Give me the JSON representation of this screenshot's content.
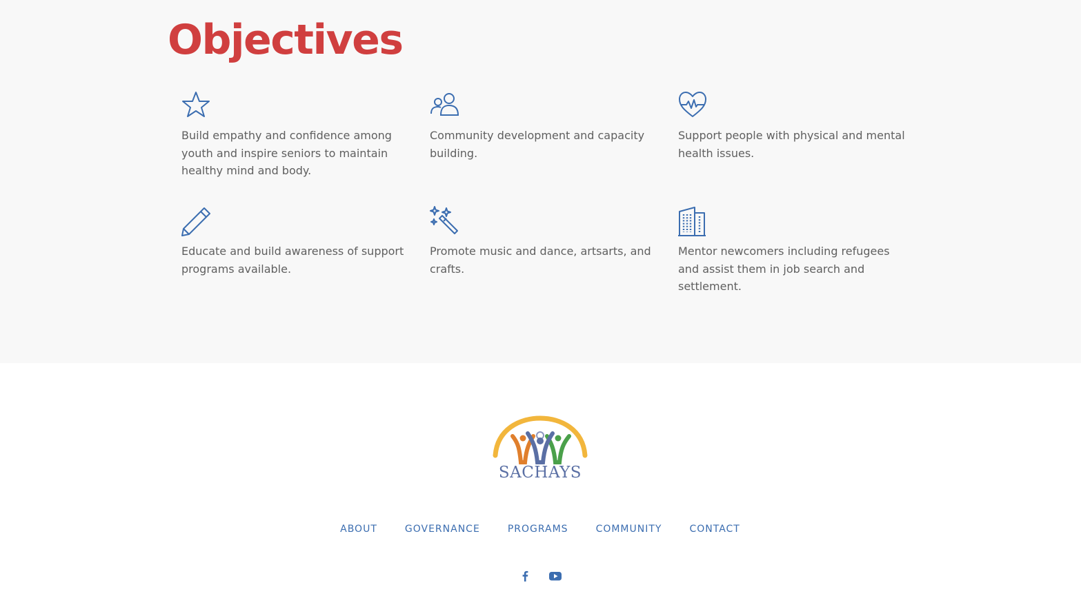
{
  "objectives": {
    "title": "Objectives",
    "items": [
      {
        "icon": "star-icon",
        "text": "Build empathy and confidence among youth and inspire seniors to maintain healthy mind and body."
      },
      {
        "icon": "users-icon",
        "text": "Community development and capacity building."
      },
      {
        "icon": "heart-pulse-icon",
        "text": "Support people with physical and mental health issues."
      },
      {
        "icon": "pencil-icon",
        "text": "Educate and build awareness of support programs available."
      },
      {
        "icon": "magic-wand-icon",
        "text": "Promote music and dance, artsarts, and crafts."
      },
      {
        "icon": "building-icon",
        "text": "Mentor newcomers including refugees and assist them in job search and settlement."
      }
    ]
  },
  "footer": {
    "logo_text": "SACHAYS",
    "nav": [
      "ABOUT",
      "GOVERNANCE",
      "PROGRAMS",
      "COMMUNITY",
      "CONTACT"
    ],
    "social": [
      "facebook-icon",
      "youtube-icon"
    ]
  },
  "colors": {
    "heading": "#d03f3f",
    "icon": "#3b6db0",
    "body_text": "#5f5f5f",
    "section_bg": "#f8f8f8",
    "logo_arc": "#f2b63c",
    "logo_orange": "#e07f2c",
    "logo_blue": "#5a6fa4",
    "logo_green": "#4aa04a"
  }
}
